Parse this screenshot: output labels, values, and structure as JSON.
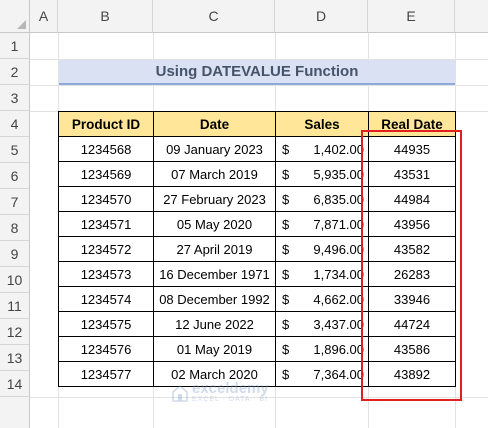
{
  "columns": [
    "A",
    "B",
    "C",
    "D",
    "E"
  ],
  "rows": [
    "1",
    "2",
    "3",
    "4",
    "5",
    "6",
    "7",
    "8",
    "9",
    "10",
    "11",
    "12",
    "13",
    "14"
  ],
  "title": "Using DATEVALUE Function",
  "table": {
    "headers": [
      "Product ID",
      "Date",
      "Sales",
      "Real Date"
    ],
    "rows": [
      {
        "id": "1234568",
        "date": "09 January 2023",
        "currency": "$",
        "sales": "1,402.00",
        "real": "44935"
      },
      {
        "id": "1234569",
        "date": "07 March 2019",
        "currency": "$",
        "sales": "5,935.00",
        "real": "43531"
      },
      {
        "id": "1234570",
        "date": "27 February 2023",
        "currency": "$",
        "sales": "6,835.00",
        "real": "44984"
      },
      {
        "id": "1234571",
        "date": "05 May 2020",
        "currency": "$",
        "sales": "7,871.00",
        "real": "43956"
      },
      {
        "id": "1234572",
        "date": "27 April 2019",
        "currency": "$",
        "sales": "9,496.00",
        "real": "43582"
      },
      {
        "id": "1234573",
        "date": "16 December 1971",
        "currency": "$",
        "sales": "1,734.00",
        "real": "26283"
      },
      {
        "id": "1234574",
        "date": "08 December 1992",
        "currency": "$",
        "sales": "4,662.00",
        "real": "33946"
      },
      {
        "id": "1234575",
        "date": "12 June 2022",
        "currency": "$",
        "sales": "3,437.00",
        "real": "44724"
      },
      {
        "id": "1234576",
        "date": "01 May 2019",
        "currency": "$",
        "sales": "1,896.00",
        "real": "43586"
      },
      {
        "id": "1234577",
        "date": "02 March 2020",
        "currency": "$",
        "sales": "7,364.00",
        "real": "43892"
      }
    ]
  },
  "watermark": {
    "name": "exceldemy",
    "sub": "EXCEL · DATA · BI"
  },
  "colors": {
    "header_fill": "#ffe699",
    "title_fill": "#d9e1f2",
    "highlight_border": "#e02020"
  }
}
